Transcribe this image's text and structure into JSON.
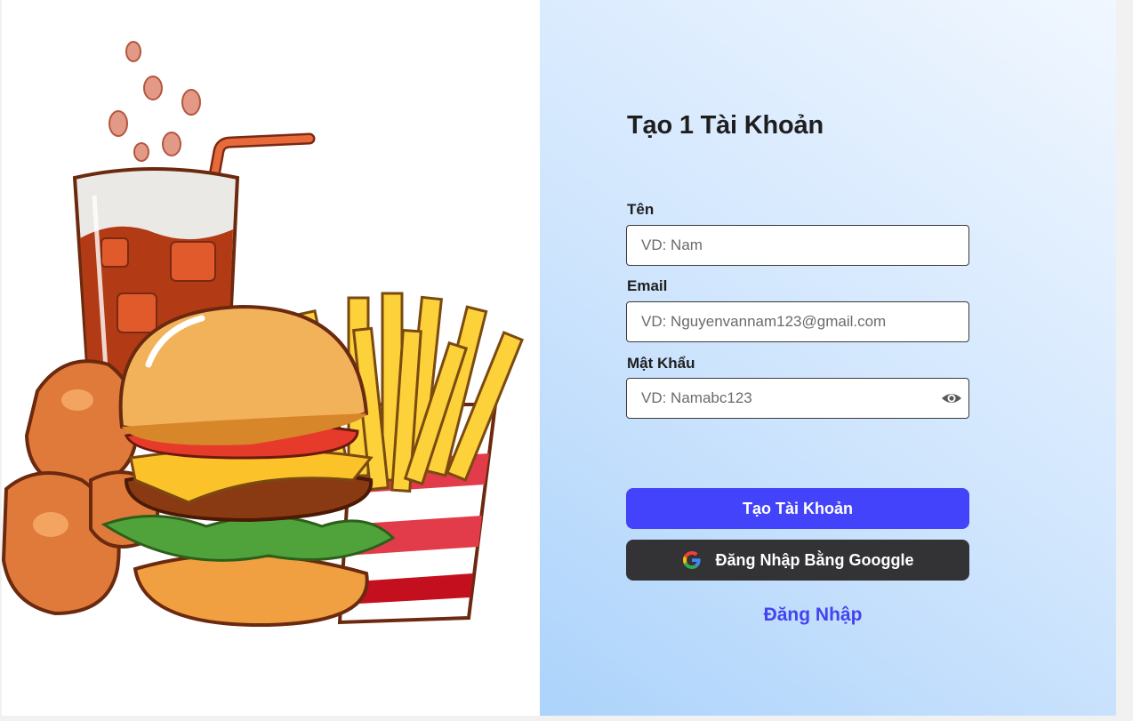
{
  "form": {
    "title": "Tạo 1 Tài Khoản",
    "name_label": "Tên",
    "name_placeholder": "VD: Nam",
    "email_label": "Email",
    "email_placeholder": "VD: Nguyenvannam123@gmail.com",
    "password_label": "Mật Khẩu",
    "password_placeholder": "VD: Namabc123",
    "password_toggle_icon": "eye-icon"
  },
  "buttons": {
    "create_account": "Tạo Tài Khoản",
    "google_login": "Đăng Nhập Bằng Googgle",
    "google_icon": "google-icon"
  },
  "links": {
    "login": "Đăng Nhập"
  },
  "illustration": {
    "subject": "fast-food-illustration"
  },
  "colors": {
    "primary_button": "#4343fb",
    "google_button": "#333335",
    "link": "#4343f0",
    "panel_gradient_start": "#acd3fb",
    "panel_gradient_end": "#f1f7ff"
  }
}
